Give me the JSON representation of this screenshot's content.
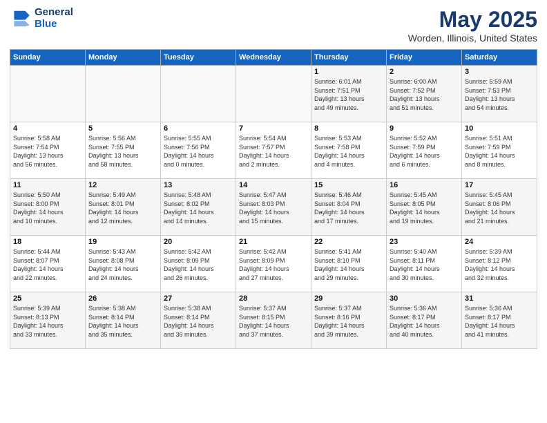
{
  "logo": {
    "line1": "General",
    "line2": "Blue"
  },
  "title": "May 2025",
  "subtitle": "Worden, Illinois, United States",
  "days_of_week": [
    "Sunday",
    "Monday",
    "Tuesday",
    "Wednesday",
    "Thursday",
    "Friday",
    "Saturday"
  ],
  "weeks": [
    [
      {
        "day": "",
        "info": ""
      },
      {
        "day": "",
        "info": ""
      },
      {
        "day": "",
        "info": ""
      },
      {
        "day": "",
        "info": ""
      },
      {
        "day": "1",
        "info": "Sunrise: 6:01 AM\nSunset: 7:51 PM\nDaylight: 13 hours\nand 49 minutes."
      },
      {
        "day": "2",
        "info": "Sunrise: 6:00 AM\nSunset: 7:52 PM\nDaylight: 13 hours\nand 51 minutes."
      },
      {
        "day": "3",
        "info": "Sunrise: 5:59 AM\nSunset: 7:53 PM\nDaylight: 13 hours\nand 54 minutes."
      }
    ],
    [
      {
        "day": "4",
        "info": "Sunrise: 5:58 AM\nSunset: 7:54 PM\nDaylight: 13 hours\nand 56 minutes."
      },
      {
        "day": "5",
        "info": "Sunrise: 5:56 AM\nSunset: 7:55 PM\nDaylight: 13 hours\nand 58 minutes."
      },
      {
        "day": "6",
        "info": "Sunrise: 5:55 AM\nSunset: 7:56 PM\nDaylight: 14 hours\nand 0 minutes."
      },
      {
        "day": "7",
        "info": "Sunrise: 5:54 AM\nSunset: 7:57 PM\nDaylight: 14 hours\nand 2 minutes."
      },
      {
        "day": "8",
        "info": "Sunrise: 5:53 AM\nSunset: 7:58 PM\nDaylight: 14 hours\nand 4 minutes."
      },
      {
        "day": "9",
        "info": "Sunrise: 5:52 AM\nSunset: 7:59 PM\nDaylight: 14 hours\nand 6 minutes."
      },
      {
        "day": "10",
        "info": "Sunrise: 5:51 AM\nSunset: 7:59 PM\nDaylight: 14 hours\nand 8 minutes."
      }
    ],
    [
      {
        "day": "11",
        "info": "Sunrise: 5:50 AM\nSunset: 8:00 PM\nDaylight: 14 hours\nand 10 minutes."
      },
      {
        "day": "12",
        "info": "Sunrise: 5:49 AM\nSunset: 8:01 PM\nDaylight: 14 hours\nand 12 minutes."
      },
      {
        "day": "13",
        "info": "Sunrise: 5:48 AM\nSunset: 8:02 PM\nDaylight: 14 hours\nand 14 minutes."
      },
      {
        "day": "14",
        "info": "Sunrise: 5:47 AM\nSunset: 8:03 PM\nDaylight: 14 hours\nand 15 minutes."
      },
      {
        "day": "15",
        "info": "Sunrise: 5:46 AM\nSunset: 8:04 PM\nDaylight: 14 hours\nand 17 minutes."
      },
      {
        "day": "16",
        "info": "Sunrise: 5:45 AM\nSunset: 8:05 PM\nDaylight: 14 hours\nand 19 minutes."
      },
      {
        "day": "17",
        "info": "Sunrise: 5:45 AM\nSunset: 8:06 PM\nDaylight: 14 hours\nand 21 minutes."
      }
    ],
    [
      {
        "day": "18",
        "info": "Sunrise: 5:44 AM\nSunset: 8:07 PM\nDaylight: 14 hours\nand 22 minutes."
      },
      {
        "day": "19",
        "info": "Sunrise: 5:43 AM\nSunset: 8:08 PM\nDaylight: 14 hours\nand 24 minutes."
      },
      {
        "day": "20",
        "info": "Sunrise: 5:42 AM\nSunset: 8:09 PM\nDaylight: 14 hours\nand 26 minutes."
      },
      {
        "day": "21",
        "info": "Sunrise: 5:42 AM\nSunset: 8:09 PM\nDaylight: 14 hours\nand 27 minutes."
      },
      {
        "day": "22",
        "info": "Sunrise: 5:41 AM\nSunset: 8:10 PM\nDaylight: 14 hours\nand 29 minutes."
      },
      {
        "day": "23",
        "info": "Sunrise: 5:40 AM\nSunset: 8:11 PM\nDaylight: 14 hours\nand 30 minutes."
      },
      {
        "day": "24",
        "info": "Sunrise: 5:39 AM\nSunset: 8:12 PM\nDaylight: 14 hours\nand 32 minutes."
      }
    ],
    [
      {
        "day": "25",
        "info": "Sunrise: 5:39 AM\nSunset: 8:13 PM\nDaylight: 14 hours\nand 33 minutes."
      },
      {
        "day": "26",
        "info": "Sunrise: 5:38 AM\nSunset: 8:14 PM\nDaylight: 14 hours\nand 35 minutes."
      },
      {
        "day": "27",
        "info": "Sunrise: 5:38 AM\nSunset: 8:14 PM\nDaylight: 14 hours\nand 36 minutes."
      },
      {
        "day": "28",
        "info": "Sunrise: 5:37 AM\nSunset: 8:15 PM\nDaylight: 14 hours\nand 37 minutes."
      },
      {
        "day": "29",
        "info": "Sunrise: 5:37 AM\nSunset: 8:16 PM\nDaylight: 14 hours\nand 39 minutes."
      },
      {
        "day": "30",
        "info": "Sunrise: 5:36 AM\nSunset: 8:17 PM\nDaylight: 14 hours\nand 40 minutes."
      },
      {
        "day": "31",
        "info": "Sunrise: 5:36 AM\nSunset: 8:17 PM\nDaylight: 14 hours\nand 41 minutes."
      }
    ]
  ]
}
